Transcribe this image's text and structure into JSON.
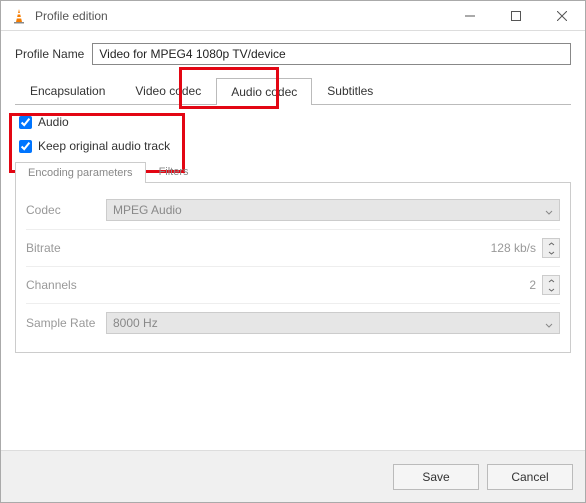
{
  "window": {
    "title": "Profile edition"
  },
  "profile": {
    "label": "Profile Name",
    "value": "Video for MPEG4 1080p TV/device"
  },
  "tabs": {
    "encapsulation": "Encapsulation",
    "video": "Video codec",
    "audio": "Audio codec",
    "subtitles": "Subtitles"
  },
  "checks": {
    "audio": "Audio",
    "keep": "Keep original audio track"
  },
  "subtabs": {
    "encparams": "Encoding parameters",
    "filters": "Filters"
  },
  "params": {
    "codec": {
      "label": "Codec",
      "value": "MPEG Audio"
    },
    "bitrate": {
      "label": "Bitrate",
      "value": "128 kb/s"
    },
    "channels": {
      "label": "Channels",
      "value": "2"
    },
    "samplerate": {
      "label": "Sample Rate",
      "value": "8000 Hz"
    }
  },
  "buttons": {
    "save": "Save",
    "cancel": "Cancel"
  },
  "colors": {
    "highlight": "#e30613"
  }
}
